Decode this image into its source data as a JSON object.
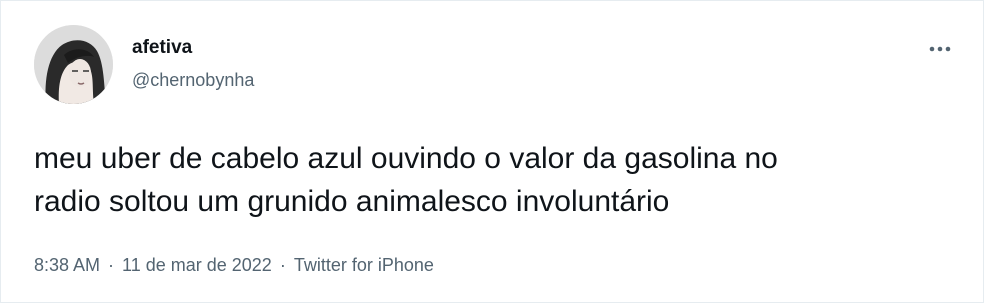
{
  "tweet": {
    "display_name": "afetiva",
    "handle": "@chernobynha",
    "text": "meu uber de cabelo azul ouvindo o valor da gasolina no\nradio soltou um grunido animalesco involuntário",
    "time": "8:38 AM",
    "separator": "·",
    "date": "11 de mar de 2022",
    "source": "Twitter for iPhone",
    "avatar_icon": "profile-photo",
    "more_icon": "more-options-icon"
  },
  "colors": {
    "text": "#0f1419",
    "secondary": "#536471",
    "background": "#ffffff"
  }
}
